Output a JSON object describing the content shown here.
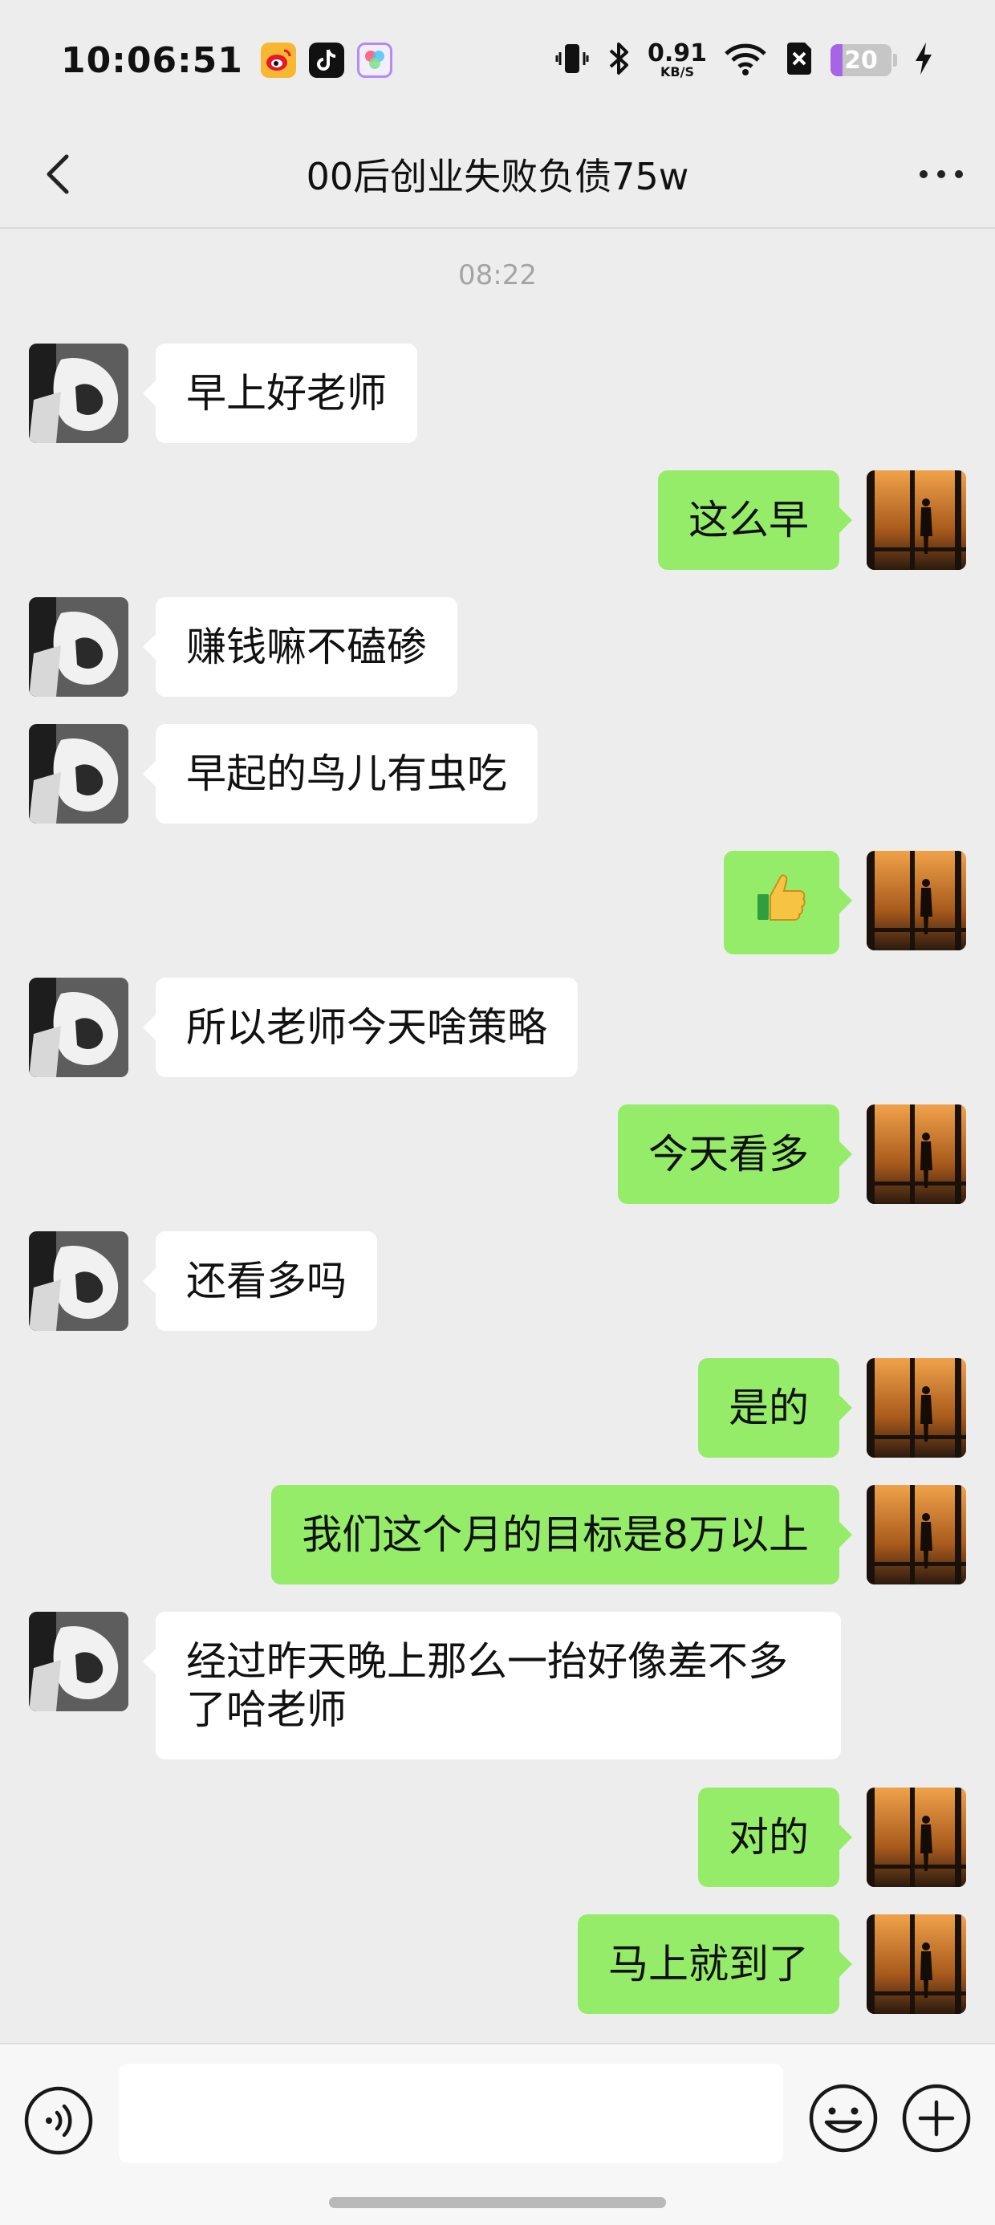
{
  "status_bar": {
    "time": "10:06:51",
    "net_speed_value": "0.91",
    "net_speed_unit": "KB/S",
    "battery_level": "20",
    "battery_fraction": 0.2,
    "icons": [
      "weibo-icon",
      "tiktok-icon",
      "multicolor-app-icon",
      "vibrate-icon",
      "bluetooth-icon",
      "wifi-icon",
      "sim-off-icon",
      "charging-icon"
    ]
  },
  "header": {
    "title": "00后创业失败负债75w",
    "back_icon": "chevron-left-icon",
    "more_icon": "more-dots-icon"
  },
  "chat": {
    "timestamp": "08:22",
    "messages": [
      {
        "side": "left",
        "text": "早上好老师"
      },
      {
        "side": "right",
        "text": "这么早"
      },
      {
        "side": "left",
        "text": "赚钱嘛不磕碜"
      },
      {
        "side": "left",
        "text": "早起的鸟儿有虫吃"
      },
      {
        "side": "right",
        "text": "",
        "emoji": "thumbs-up-emoji"
      },
      {
        "side": "left",
        "text": "所以老师今天啥策略"
      },
      {
        "side": "right",
        "text": "今天看多"
      },
      {
        "side": "left",
        "text": "还看多吗"
      },
      {
        "side": "right",
        "text": "是的"
      },
      {
        "side": "right",
        "text": "我们这个月的目标是8万以上"
      },
      {
        "side": "left",
        "text": "经过昨天晚上那么一抬好像差不多了哈老师"
      },
      {
        "side": "right",
        "text": "对的"
      },
      {
        "side": "right",
        "text": "马上就到了"
      }
    ]
  },
  "input_bar": {
    "voice_icon": "voice-icon",
    "emoji_icon": "emoji-icon",
    "plus_icon": "plus-icon",
    "input_value": ""
  },
  "colors": {
    "background": "#ededed",
    "my_bubble": "#95ec69",
    "other_bubble": "#ffffff",
    "battery_accent": "#a665e6"
  }
}
